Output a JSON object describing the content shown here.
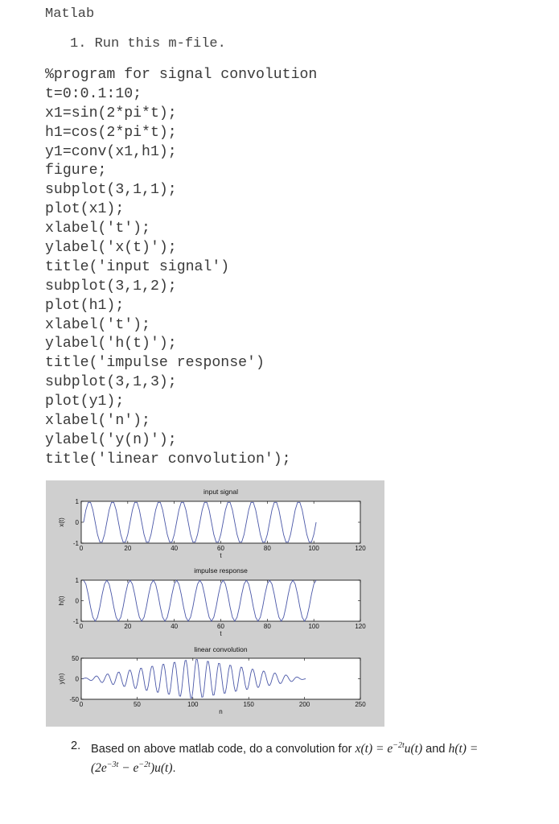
{
  "heading": "Matlab",
  "step1": "1. Run this m-file.",
  "code_lines": [
    "%program for signal convolution",
    "t=0:0.1:10;",
    "x1=sin(2*pi*t);",
    "h1=cos(2*pi*t);",
    "y1=conv(x1,h1);",
    "figure;",
    "subplot(3,1,1);",
    "plot(x1);",
    "xlabel('t');",
    "ylabel('x(t)');",
    "title('input signal')",
    "subplot(3,1,2);",
    "plot(h1);",
    "xlabel('t');",
    "ylabel('h(t)');",
    "title('impulse response')",
    "subplot(3,1,3);",
    "plot(y1);",
    "xlabel('n');",
    "ylabel('y(n)');",
    "title('linear convolution');"
  ],
  "chart_data": [
    {
      "type": "line",
      "title": "input signal",
      "xlabel": "t",
      "ylabel": "x(t)",
      "xlim": [
        0,
        120
      ],
      "ylim": [
        -1,
        1
      ],
      "xticks": [
        0,
        20,
        40,
        60,
        80,
        100,
        120
      ],
      "yticks": [
        -1,
        0,
        1
      ],
      "series": [
        {
          "name": "x1",
          "function": "sin(2*pi*t)",
          "t_start": 0,
          "t_step": 0.1,
          "t_end": 10,
          "n_points": 101,
          "color": "#4b58a8"
        }
      ]
    },
    {
      "type": "line",
      "title": "impulse response",
      "xlabel": "t",
      "ylabel": "h(t)",
      "xlim": [
        0,
        120
      ],
      "ylim": [
        -1,
        1
      ],
      "xticks": [
        0,
        20,
        40,
        60,
        80,
        100,
        120
      ],
      "yticks": [
        -1,
        0,
        1
      ],
      "series": [
        {
          "name": "h1",
          "function": "cos(2*pi*t)",
          "t_start": 0,
          "t_step": 0.1,
          "t_end": 10,
          "n_points": 101,
          "color": "#4b58a8"
        }
      ]
    },
    {
      "type": "line",
      "title": "linear convolution",
      "xlabel": "n",
      "ylabel": "y(n)",
      "xlim": [
        0,
        250
      ],
      "ylim": [
        -50,
        50
      ],
      "xticks": [
        0,
        50,
        100,
        150,
        200,
        250
      ],
      "yticks": [
        -50,
        0,
        50
      ],
      "series": [
        {
          "name": "y1",
          "function": "conv(x1,h1)",
          "n_points": 201,
          "peak_abs": 50,
          "color": "#4b58a8"
        }
      ]
    }
  ],
  "question2": {
    "number": "2.",
    "text_before": "Based on above matlab code, do a convolution for ",
    "x_def": "x(t) = e",
    "x_exp": "−2t",
    "x_tail": "u(t)",
    "mid": " and ",
    "h_def": "h(t) =",
    "line2_a": "(2e",
    "line2_exp1": "−3t",
    "line2_b": " − e",
    "line2_exp2": "−2t",
    "line2_c": ")u(t)",
    "end": "."
  }
}
